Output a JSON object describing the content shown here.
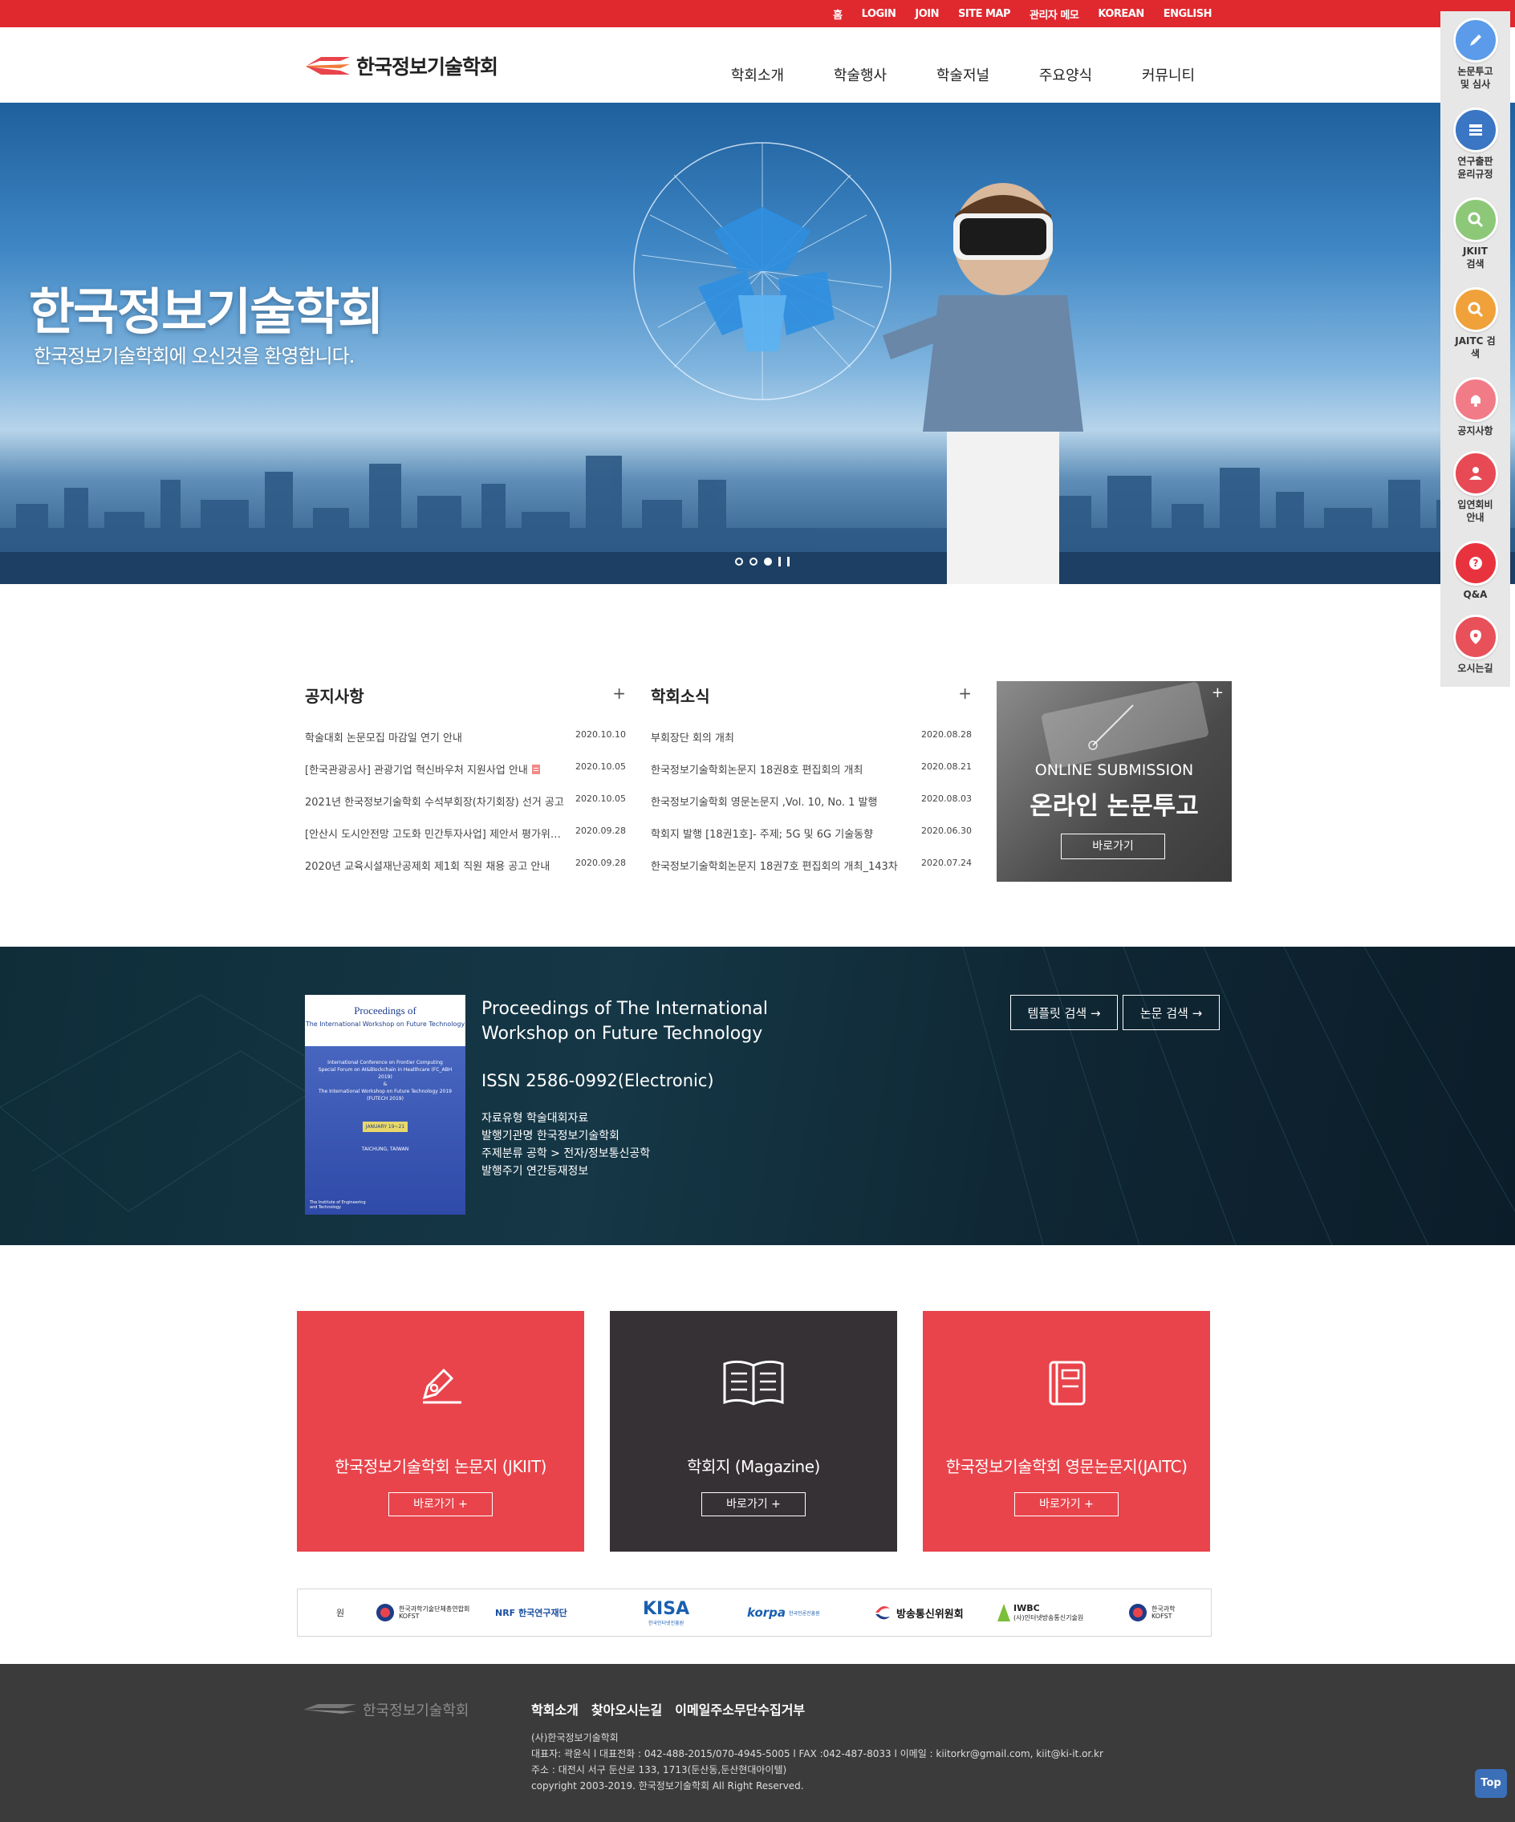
{
  "topbar": {
    "links": [
      "홈",
      "LOGIN",
      "JOIN",
      "SITE MAP",
      "관리자 메모",
      "KOREAN",
      "ENGLISH"
    ]
  },
  "header": {
    "logo_text": "한국정보기술학회",
    "nav": [
      "학회소개",
      "학술행사",
      "학술저널",
      "주요양식",
      "커뮤니티"
    ]
  },
  "hero": {
    "title": "한국정보기술학회",
    "subtitle": "한국정보기술학회에 오신것을 환영합니다."
  },
  "quick_menu": [
    {
      "label": "논문투고\n및 심사",
      "icon": "pencil-icon",
      "color": "#5b9bea"
    },
    {
      "label": "연구출판\n윤리규정",
      "icon": "document-icon",
      "color": "#3a76c4"
    },
    {
      "label": "JKIIT\n검색",
      "icon": "search-icon",
      "color": "#8cc878"
    },
    {
      "label": "JAITC 검\n색",
      "icon": "search-icon",
      "color": "#f0a13a"
    },
    {
      "label": "공지사항",
      "icon": "bell-icon",
      "color": "#f27b88"
    },
    {
      "label": "입연회비\n안내",
      "icon": "person-icon",
      "color": "#e84a55"
    },
    {
      "label": "Q&A",
      "icon": "question-icon",
      "color": "#e8333f"
    },
    {
      "label": "오시는길",
      "icon": "map-pin-icon",
      "color": "#e8505a"
    }
  ],
  "notice": {
    "title": "공지사항",
    "more": "+",
    "items": [
      {
        "title": "학술대회 논문모집 마감일 연기 안내",
        "date": "2020.10.10"
      },
      {
        "title": "[한국관광공사] 관광기업 혁신바우처 지원사업 안내",
        "date": "2020.10.05"
      },
      {
        "title": "2021년 한국정보기술학회 수석부회장(차기회장) 선거 공고",
        "date": "2020.10.05"
      },
      {
        "title": "[안산시 도시안전망 고도화 민간투자사업] 제안서 평가위원 모집",
        "date": "2020.09.28"
      },
      {
        "title": "2020년 교육시설재난공제회 제1회 직원 채용 공고 안내",
        "date": "2020.09.28"
      }
    ]
  },
  "news": {
    "title": "학회소식",
    "more": "+",
    "items": [
      {
        "title": "부회장단 회의 개최",
        "date": "2020.08.28"
      },
      {
        "title": "한국정보기술학회논문지 18권8호 편집회의 개최",
        "date": "2020.08.21"
      },
      {
        "title": "한국정보기술학회 영문논문지 ,Vol. 10, No. 1 발행",
        "date": "2020.08.03"
      },
      {
        "title": "학회지 발행 [18권1호]- 주제; 5G 및 6G 기술동향",
        "date": "2020.06.30"
      },
      {
        "title": "한국정보기술학회논문지 18권7호 편집회의 개최_143차",
        "date": "2020.07.24"
      }
    ]
  },
  "submission": {
    "en": "ONLINE SUBMISSION",
    "ko": "온라인 논문투고",
    "button": "바로가기",
    "more": "+"
  },
  "proceedings": {
    "cover_title": "Proceedings of",
    "cover_subtitle": "The International Workshop on Future Technology",
    "cover_lines": [
      "International Conference on Frontier Computing",
      "Special Forum on AI&Blockchain in Healthcare (FC_ABH 2019)",
      "&",
      "The International Workshop on Future Technology 2019 (FUTECH 2019)"
    ],
    "cover_date": "JANUARY 19~21",
    "cover_place": "TAICHUNG, TAIWAN",
    "cover_org": "The Institute of Engineering and Technology",
    "title": "Proceedings of The International Workshop on Future Technology",
    "issn": "ISSN 2586-0992(Electronic)",
    "meta": [
      "자료유형 학술대회자료",
      "발행기관명 한국정보기술학회",
      "주제분류 공학 > 전자/정보통신공학",
      "발행주기 연간등재정보"
    ],
    "buttons": [
      "템플릿 검색 →",
      "논문 검색 →"
    ]
  },
  "cards": [
    {
      "title": "한국정보기술학회 논문지 (JKIIT)",
      "button": "바로가기 +",
      "icon": "pen-icon",
      "color": "#e9444c"
    },
    {
      "title": "학회지 (Magazine)",
      "button": "바로가기 +",
      "icon": "book-icon",
      "color": "#363134"
    },
    {
      "title": "한국정보기술학회 영문논문지(JAITC)",
      "button": "바로가기 +",
      "icon": "notebook-icon",
      "color": "#e9444c"
    }
  ],
  "partners": [
    {
      "name": "원"
    },
    {
      "name": "한국과학기술단체총연합회 KOFST"
    },
    {
      "name": "NRF 한국연구재단"
    },
    {
      "name": "KISA"
    },
    {
      "name": "한국인터넷진흥원"
    },
    {
      "name": "korpa"
    },
    {
      "name": "한국언론진흥원"
    },
    {
      "name": "방송통신위원회"
    },
    {
      "name": "IWBC"
    },
    {
      "name": "(사)인터넷방송통신기술원"
    },
    {
      "name": "한국과학 KOFST"
    }
  ],
  "footer": {
    "logo_text": "한국정보기술학회",
    "nav": [
      "학회소개",
      "찾아오시는길",
      "이메일주소무단수집거부"
    ],
    "info": [
      "(사)한국정보기술학회",
      "대표자: 곽윤식 l  대표전화 : 042-488-2015/070-4945-5005 l  FAX :042-487-8033  l 이메일 : kiitorkr@gmail.com, kiit@ki-it.or.kr",
      "주소 : 대전시 서구 둔산로 133, 1713(둔산동,둔산현대아이텔)",
      "copyright 2003-2019. 한국정보기술학회 All Right Reserved."
    ],
    "top_button": "Top"
  },
  "colors": {
    "brand_red": "#e0282f",
    "dark": "#3b3b3b"
  }
}
